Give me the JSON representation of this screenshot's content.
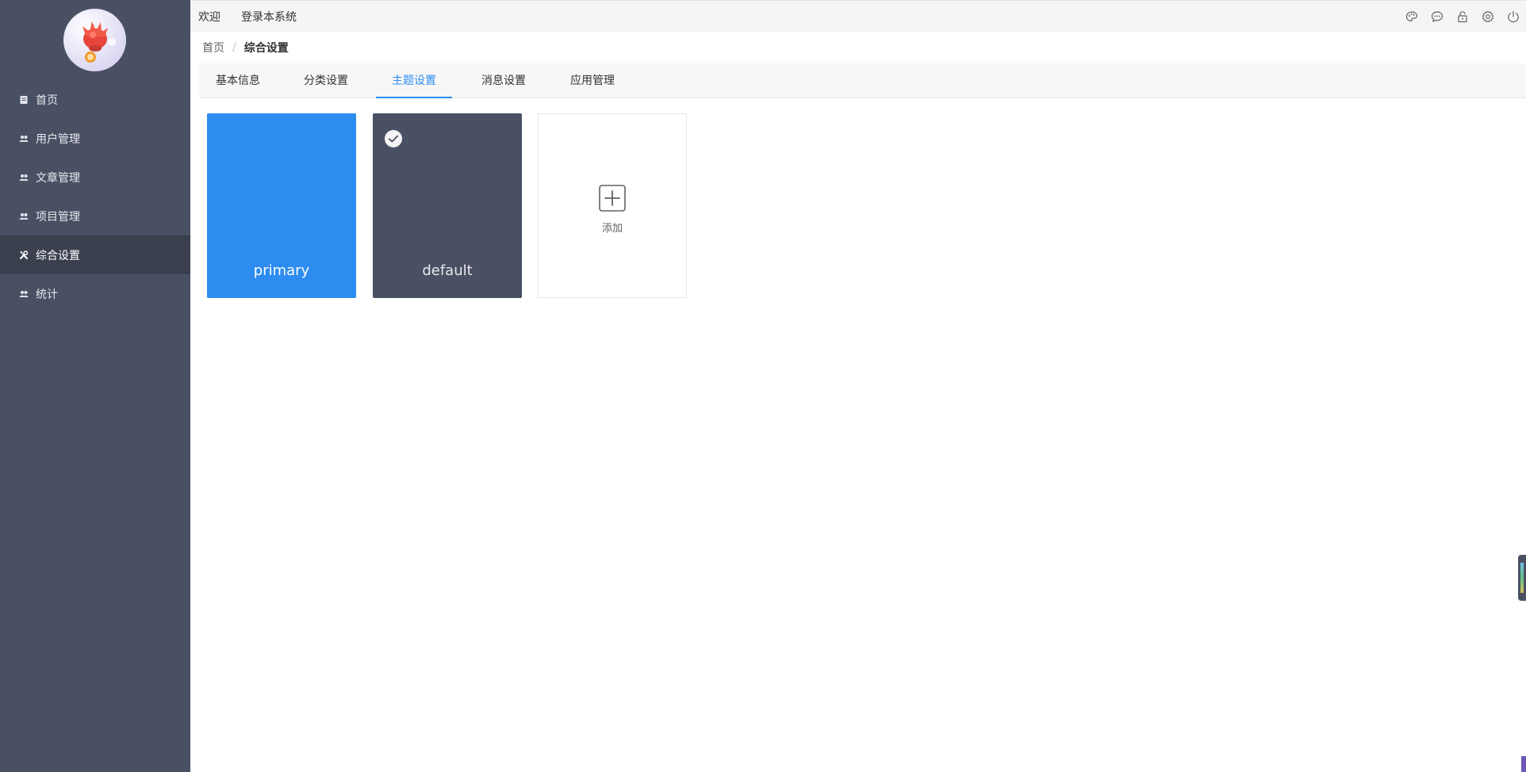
{
  "sidebar": {
    "items": [
      {
        "label": "首页",
        "icon": "doc-icon",
        "active": false
      },
      {
        "label": "用户管理",
        "icon": "users-icon",
        "active": false
      },
      {
        "label": "文章管理",
        "icon": "users-icon",
        "active": false
      },
      {
        "label": "项目管理",
        "icon": "users-icon",
        "active": false
      },
      {
        "label": "综合设置",
        "icon": "tools-icon",
        "active": true
      },
      {
        "label": "统计",
        "icon": "users-icon",
        "active": false
      }
    ]
  },
  "topbar": {
    "welcome": "欢迎",
    "login_info": "登录本系统",
    "icons": [
      "palette-icon",
      "chat-icon",
      "lock-icon",
      "gear-icon",
      "power-icon"
    ]
  },
  "breadcrumb": {
    "home": "首页",
    "separator": "/",
    "current": "综合设置"
  },
  "tabs": [
    {
      "label": "基本信息"
    },
    {
      "label": "分类设置"
    },
    {
      "label": "主题设置",
      "active": true
    },
    {
      "label": "消息设置"
    },
    {
      "label": "应用管理"
    }
  ],
  "themes": {
    "cards": [
      {
        "label": "primary",
        "color": "#2d8cf0",
        "selected": false
      },
      {
        "label": "default",
        "color": "#4a5064",
        "selected": true
      }
    ],
    "add_label": "添加"
  },
  "colors": {
    "sidebar_bg": "#4a5064",
    "sidebar_active_bg": "#3b404f",
    "accent": "#2d8cf0"
  }
}
